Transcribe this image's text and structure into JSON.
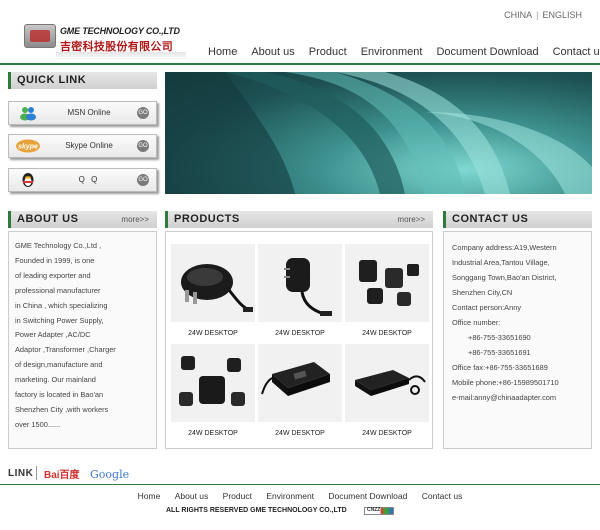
{
  "header": {
    "logo_en": "GME TECHNOLOGY CO.,LTD",
    "logo_cn": "吉密科技股份有限公司",
    "lang": [
      "CHINA",
      "ENGLISH"
    ],
    "nav": [
      "Home",
      "About us",
      "Product",
      "Environment",
      "Document Download",
      "Contact us"
    ]
  },
  "quick_link": {
    "title": "QUICK LINK",
    "items": [
      {
        "label": "MSN Online",
        "icon": "msn-icon",
        "go": "GO"
      },
      {
        "label": "Skype Online",
        "icon": "skype-icon",
        "go": "GO"
      },
      {
        "label": "Q Q",
        "icon": "qq-icon",
        "go": "GO"
      }
    ]
  },
  "about": {
    "title": "ABOUT US",
    "more": "more>>",
    "lines": [
      "GME Technology Co.,Ltd ,",
      "Founded in 1999, is one",
      "of leading exporter and",
      "professional manufacturer",
      "in China , which specializing",
      "in Switching Power Supply,",
      "Power Adapter ,AC/DC",
      "Adaptor ,Transformer ,Charger",
      "of design,manufacture and",
      "marketing. Our mainland",
      "factory is located in Bao'an",
      "Shenzhen City ,with workers",
      "over 1500......"
    ]
  },
  "products": {
    "title": "PRODUCTS",
    "more": "more>>",
    "items": [
      {
        "caption": "24W DESKTOP"
      },
      {
        "caption": "24W DESKTOP"
      },
      {
        "caption": "24W DESKTOP"
      },
      {
        "caption": "24W DESKTOP"
      },
      {
        "caption": "24W DESKTOP"
      },
      {
        "caption": "24W DESKTOP"
      }
    ]
  },
  "contact": {
    "title": "CONTACT US",
    "lines": [
      {
        "text": "Company address:A19,Western",
        "indent": false
      },
      {
        "text": "Industrial Area,Tantou Village,",
        "indent": false
      },
      {
        "text": "Songgang Town,Bao'an District,",
        "indent": false
      },
      {
        "text": "Shenzhen City,CN",
        "indent": false
      },
      {
        "text": "Contact person:Anny",
        "indent": false
      },
      {
        "text": "Office number:",
        "indent": false
      },
      {
        "text": "+86-755-33651690",
        "indent": true
      },
      {
        "text": "+86-755-33651691",
        "indent": true
      },
      {
        "text": "Office fax:+86-755-33651689",
        "indent": false
      },
      {
        "text": "Mobile phone:+86-15989501710",
        "indent": false
      },
      {
        "text": "e-mail:anny@chinaadapter.com",
        "indent": false
      }
    ]
  },
  "links": {
    "label": "LINK",
    "baidu": "Bai百度",
    "google": "Google"
  },
  "footer": {
    "nav": [
      "Home",
      "About us",
      "Product",
      "Environment",
      "Document Download",
      "Contact us"
    ],
    "copyright": "ALL RIGHTS RESERVED GME TECHNOLOGY CO.,LTD",
    "badge": "CNZZ"
  },
  "colors": {
    "accent_green": "#2f7a3c",
    "banner_teal": "#3c8f8d"
  }
}
